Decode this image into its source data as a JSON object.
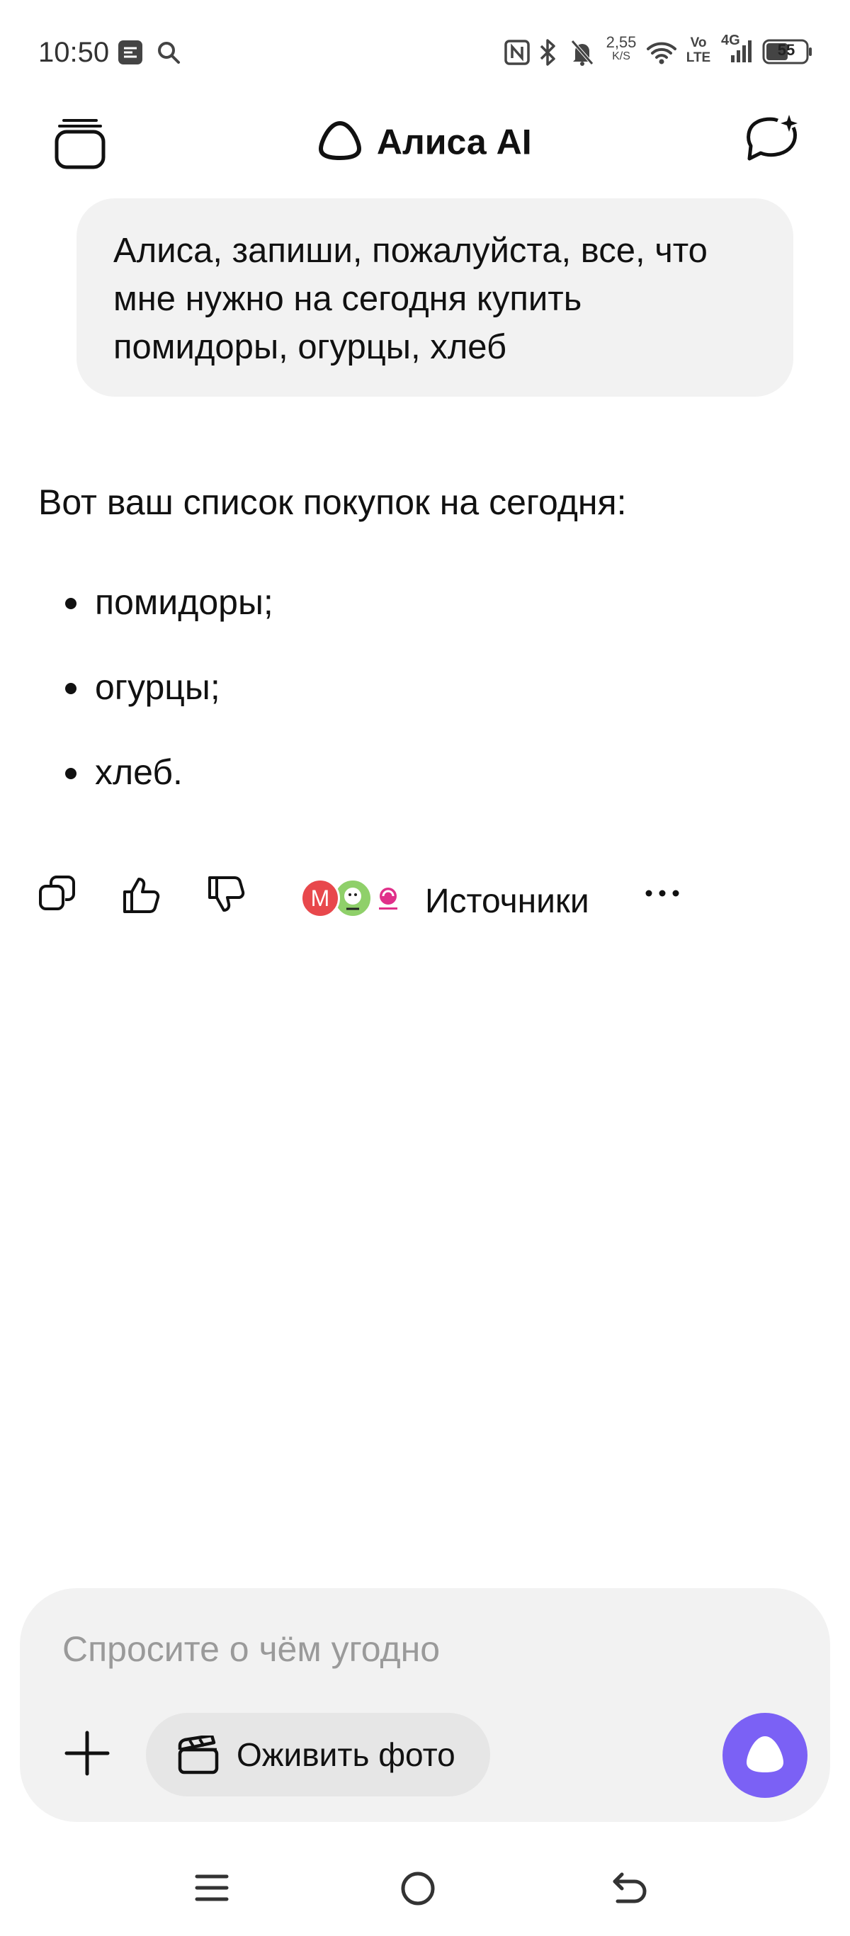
{
  "status_bar": {
    "time": "10:50",
    "net_speed_value": "2,55",
    "net_speed_unit": "K/S",
    "volte_top": "Vo",
    "volte_bottom": "LTE",
    "network_type": "4G",
    "battery_level": "55",
    "icons": [
      "gallery-notification-icon",
      "search-icon",
      "nfc-icon",
      "bluetooth-icon",
      "bell-off-icon",
      "wifi-icon",
      "signal-icon",
      "battery-icon"
    ]
  },
  "header": {
    "title": "Алиса AI",
    "left_icon": "chats-stack-icon",
    "right_icon": "new-chat-icon"
  },
  "chat": {
    "user_message": "Алиса, запиши, пожалуйста, все, что мне нужно на сегодня купить помидоры, огурцы, хлеб",
    "assistant_intro": "Вот ваш список покупок на сегодня:",
    "assistant_items": [
      "помидоры;",
      "огурцы;",
      "хлеб."
    ],
    "actions": {
      "icons": [
        "copy-icon",
        "thumbs-up-icon",
        "thumbs-down-icon",
        "more-icon"
      ],
      "source_avatar_letter": "M",
      "sources_label": "Источники"
    }
  },
  "composer": {
    "placeholder": "Спросите о чём угодно",
    "chip_label": "Оживить фото",
    "accent_color": "#7b61f5"
  },
  "navbar": {
    "icons": [
      "menu-icon",
      "home-icon",
      "back-icon"
    ]
  }
}
